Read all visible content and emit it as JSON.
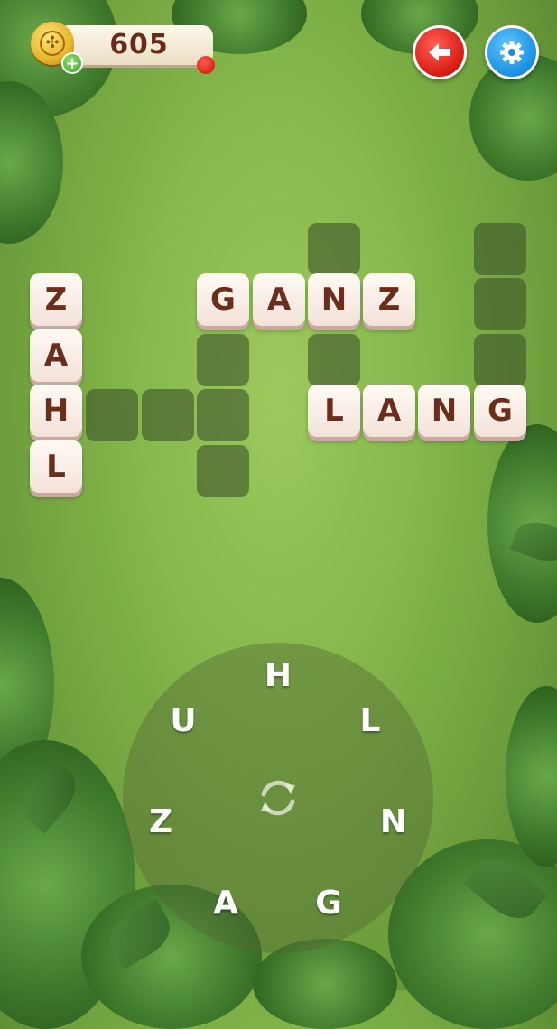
{
  "header": {
    "coins": "605",
    "add_coins_symbol": "+"
  },
  "buttons": {
    "back_icon": "arrow-left-icon",
    "settings_icon": "gear-icon",
    "shuffle_icon": "shuffle-icon"
  },
  "colors": {
    "back_button": "#d81a12",
    "settings_button": "#1a8fe0",
    "tile_face": "#fffaf4",
    "tile_text": "#6a2f1c",
    "empty_cell": "#3e562a"
  },
  "board": {
    "found_words": [
      "ZAHL",
      "GANZ",
      "LANG"
    ],
    "tiles": [
      {
        "id": "z1",
        "letter": "Z"
      },
      {
        "id": "a1",
        "letter": "A"
      },
      {
        "id": "h1",
        "letter": "H"
      },
      {
        "id": "l1",
        "letter": "L"
      },
      {
        "id": "g2",
        "letter": "G"
      },
      {
        "id": "a2",
        "letter": "A"
      },
      {
        "id": "n2",
        "letter": "N"
      },
      {
        "id": "z2",
        "letter": "Z"
      },
      {
        "id": "l3",
        "letter": "L"
      },
      {
        "id": "a3",
        "letter": "A"
      },
      {
        "id": "n3",
        "letter": "N"
      },
      {
        "id": "g3",
        "letter": "G"
      }
    ],
    "empty_cells": 10
  },
  "wheel": {
    "letters": [
      "H",
      "L",
      "N",
      "G",
      "A",
      "Z",
      "U"
    ]
  }
}
